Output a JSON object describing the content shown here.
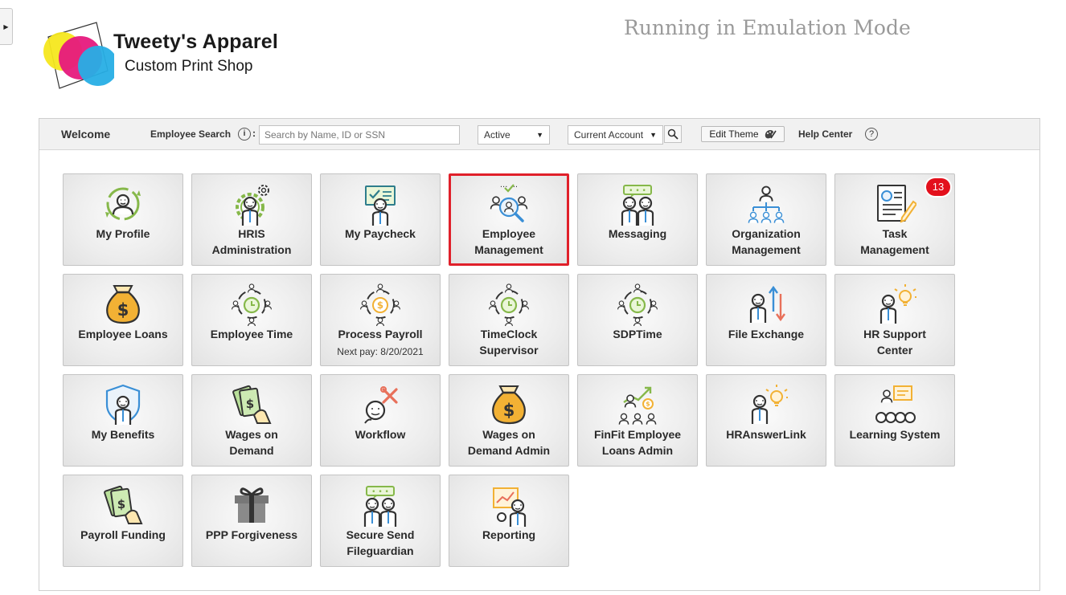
{
  "header": {
    "brand_name": "Tweety's Apparel",
    "brand_tagline": "Custom Print Shop",
    "emulation_notice": "Running in Emulation Mode"
  },
  "toolbar": {
    "welcome": "Welcome",
    "employee_search_label": "Employee Search",
    "info_glyph": "i",
    "colon": ":",
    "search_placeholder": "Search by Name, ID or SSN",
    "status_value": "Active",
    "account_value": "Current Account",
    "edit_theme_label": "Edit Theme",
    "help_center_label": "Help Center",
    "help_glyph": "?"
  },
  "tiles": [
    {
      "label": "My Profile",
      "icon": "profile-icon"
    },
    {
      "label": "HRIS\nAdministration",
      "icon": "hris-gear-icon"
    },
    {
      "label": "My Paycheck",
      "icon": "paycheck-icon"
    },
    {
      "label": "Employee\nManagement",
      "icon": "employee-management-icon"
    },
    {
      "label": "Messaging",
      "icon": "messaging-icon"
    },
    {
      "label": "Organization\nManagement",
      "icon": "org-chart-icon"
    },
    {
      "label": "Task\nManagement",
      "icon": "task-document-icon",
      "badge": "13"
    },
    {
      "label": "Employee Loans",
      "icon": "money-bag-icon"
    },
    {
      "label": "Employee Time",
      "icon": "clock-team-icon"
    },
    {
      "label": "Process Payroll",
      "icon": "dollar-team-icon",
      "sub": "Next pay: 8/20/2021"
    },
    {
      "label": "TimeClock\nSupervisor",
      "icon": "clock-team-icon"
    },
    {
      "label": "SDPTime",
      "icon": "clock-team-icon"
    },
    {
      "label": "File Exchange",
      "icon": "file-exchange-icon"
    },
    {
      "label": "HR Support\nCenter",
      "icon": "idea-person-icon"
    },
    {
      "label": "My Benefits",
      "icon": "shield-person-icon"
    },
    {
      "label": "Wages on\nDemand",
      "icon": "cash-hand-icon"
    },
    {
      "label": "Workflow",
      "icon": "workflow-tools-icon"
    },
    {
      "label": "Wages on\nDemand Admin",
      "icon": "money-bag-icon"
    },
    {
      "label": "FinFit Employee\nLoans Admin",
      "icon": "growth-team-icon"
    },
    {
      "label": "HRAnswerLink",
      "icon": "idea-person-icon"
    },
    {
      "label": "Learning System",
      "icon": "presentation-icon"
    },
    {
      "label": "Payroll Funding",
      "icon": "cash-hand-icon"
    },
    {
      "label": "PPP Forgiveness",
      "icon": "gift-icon"
    },
    {
      "label": "Secure Send\nFileguardian",
      "icon": "messaging-icon"
    },
    {
      "label": "Reporting",
      "icon": "report-chart-icon"
    }
  ],
  "selected_tile": "Employee\nManagement",
  "colors": {
    "green": "#86b84a",
    "teal": "#2e7d8c",
    "dark": "#333333",
    "gold": "#f2b134",
    "orange": "#e8705a",
    "blue": "#3a8fd6",
    "selection_red": "#e0202a",
    "badge_red": "#e3101c"
  }
}
